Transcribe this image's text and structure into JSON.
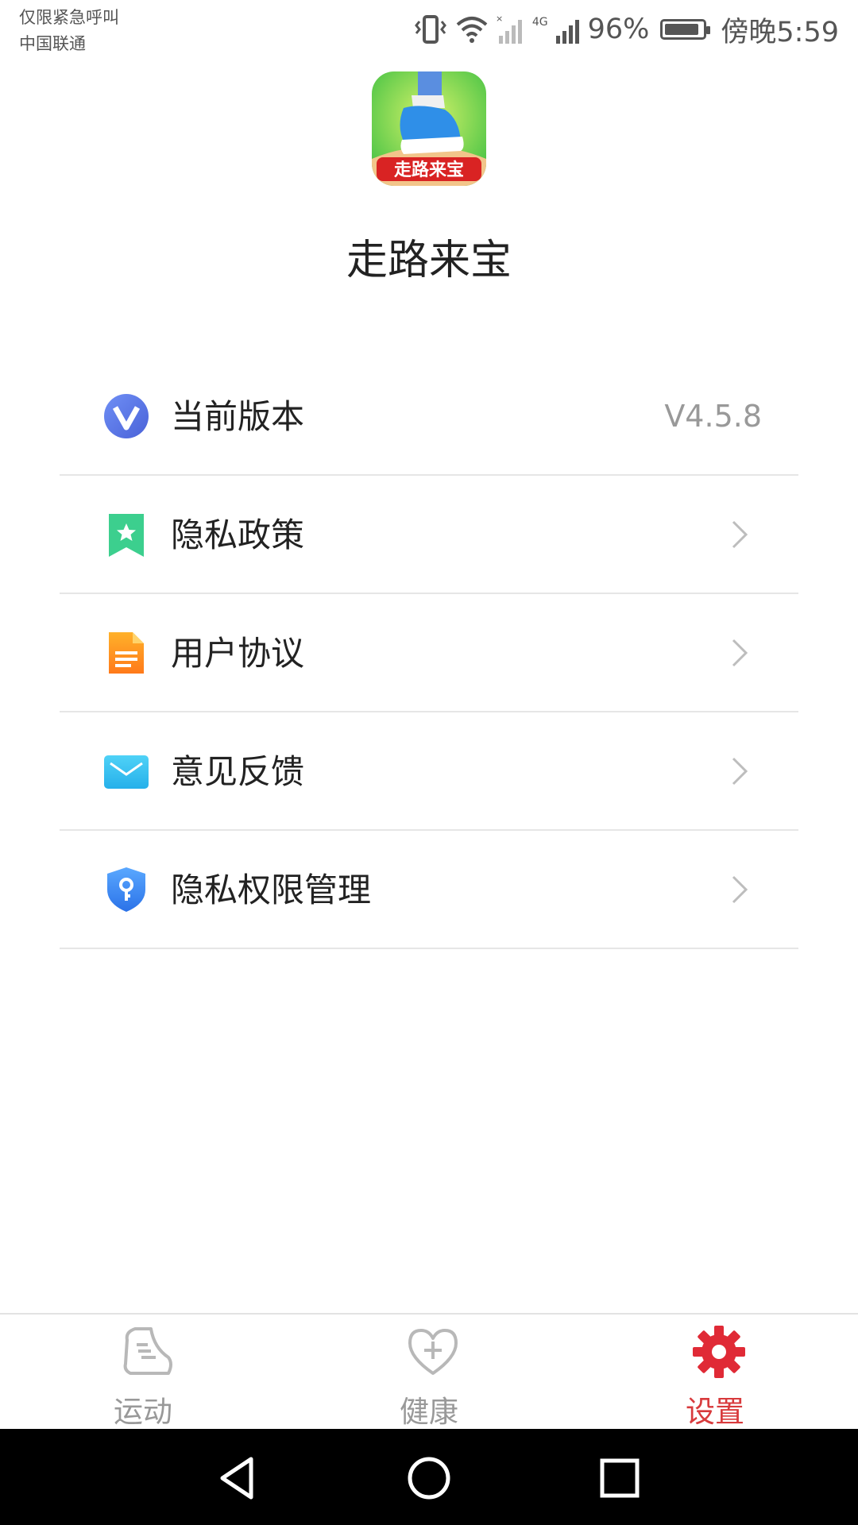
{
  "status_bar": {
    "carrier_line1": "仅限紧急呼叫",
    "carrier_line2": "中国联通",
    "network_label": "4G",
    "battery": "96%",
    "time": "傍晚5:59"
  },
  "app": {
    "logo_text": "走路来宝",
    "name": "走路来宝"
  },
  "menu": {
    "items": [
      {
        "label": "当前版本",
        "value": "V4.5.8",
        "icon": "version-v-icon"
      },
      {
        "label": "隐私政策",
        "icon": "bookmark-star-icon"
      },
      {
        "label": "用户协议",
        "icon": "document-icon"
      },
      {
        "label": "意见反馈",
        "icon": "mail-icon"
      },
      {
        "label": "隐私权限管理",
        "icon": "shield-key-icon"
      }
    ]
  },
  "bottom_nav": {
    "items": [
      {
        "label": "运动",
        "icon": "shoe-icon"
      },
      {
        "label": "健康",
        "icon": "heart-plus-icon"
      },
      {
        "label": "设置",
        "icon": "gear-icon",
        "active": true
      }
    ]
  },
  "colors": {
    "accent": "#d83a3c",
    "divider": "#e6e6e6",
    "text": "#222222",
    "muted": "#999999"
  }
}
